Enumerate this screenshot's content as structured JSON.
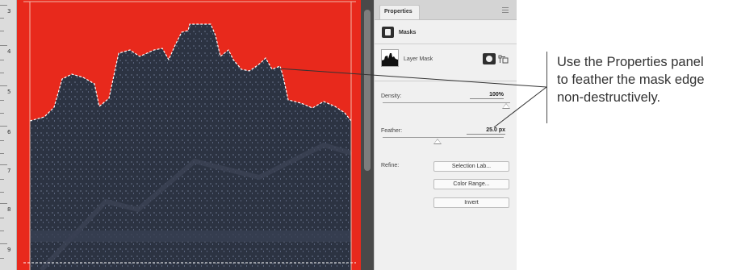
{
  "ruler": {
    "labels": [
      "3",
      "4",
      "5",
      "6",
      "7",
      "8",
      "9"
    ]
  },
  "canvas": {
    "mask_overlay_color": "#e8291c",
    "skyline_color": "#2c3342"
  },
  "panel": {
    "title": "Properties",
    "section": "Masks",
    "layer_mask_label": "Layer Mask",
    "density_label": "Density:",
    "density_value": "100%",
    "density_level_percent": 100,
    "feather_label": "Feather:",
    "feather_value": "25.0 px",
    "refine_label": "Refine:",
    "buttons": {
      "selection": "Selection Lab...",
      "color_range": "Color Range...",
      "invert": "Invert"
    }
  },
  "callout": {
    "lines": [
      "Use the Properties panel",
      "to feather the mask edge",
      "non-destructively."
    ]
  }
}
